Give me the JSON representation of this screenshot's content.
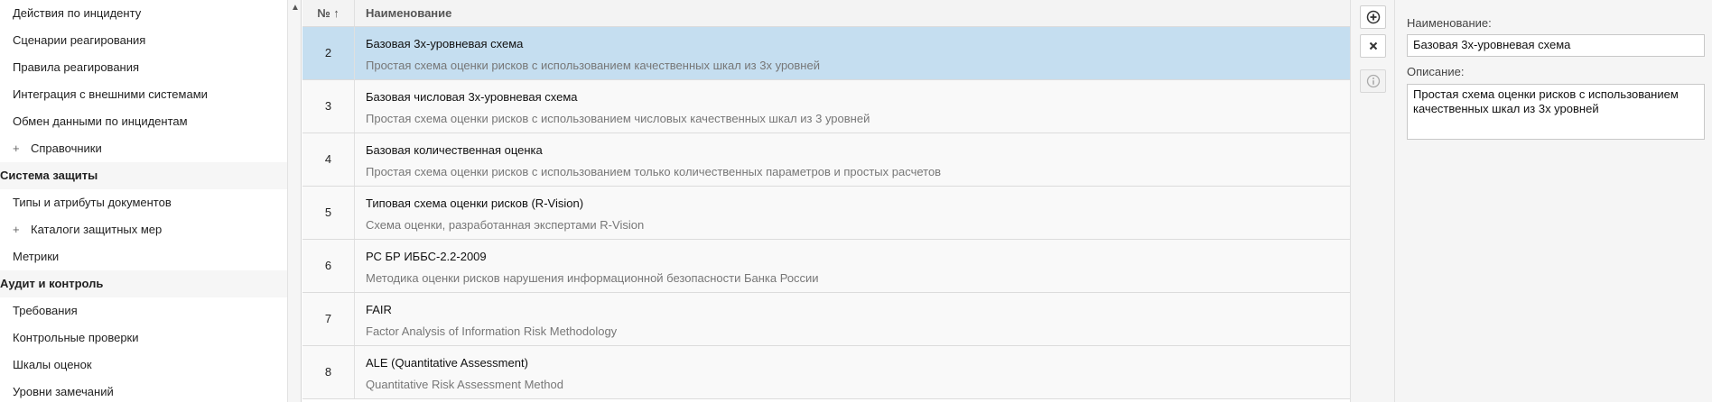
{
  "sidebar": {
    "items": [
      {
        "label": "Действия по инциденту",
        "type": "child"
      },
      {
        "label": "Сценарии реагирования",
        "type": "child"
      },
      {
        "label": "Правила реагирования",
        "type": "child"
      },
      {
        "label": "Интеграция с внешними системами",
        "type": "child"
      },
      {
        "label": "Обмен данными по инцидентам",
        "type": "child"
      },
      {
        "label": "Справочники",
        "type": "child",
        "expand": "+"
      },
      {
        "label": "Система защиты",
        "type": "group"
      },
      {
        "label": "Типы и атрибуты документов",
        "type": "child"
      },
      {
        "label": "Каталоги защитных мер",
        "type": "child",
        "expand": "+"
      },
      {
        "label": "Метрики",
        "type": "child"
      },
      {
        "label": "Аудит и контроль",
        "type": "group"
      },
      {
        "label": "Требования",
        "type": "child"
      },
      {
        "label": "Контрольные проверки",
        "type": "child"
      },
      {
        "label": "Шкалы оценок",
        "type": "child"
      },
      {
        "label": "Уровни замечаний",
        "type": "child"
      }
    ],
    "scroll_up": "▲"
  },
  "grid": {
    "columns": {
      "num": "№ ↑",
      "name": "Наименование"
    },
    "rows": [
      {
        "num": "2",
        "title": "Базовая 3х-уровневая схема",
        "desc": "Простая схема оценки рисков с использованием качественных шкал из 3х уровней",
        "selected": true
      },
      {
        "num": "3",
        "title": "Базовая числовая 3х-уровневая схема",
        "desc": "Простая схема оценки рисков с использованием числовых качественных шкал из 3 уровней"
      },
      {
        "num": "4",
        "title": "Базовая количественная оценка",
        "desc": "Простая схема оценки рисков с использованием только количественных параметров и простых расчетов"
      },
      {
        "num": "5",
        "title": "Типовая схема оценки рисков (R-Vision)",
        "desc": "Схема оценки, разработанная экспертами R-Vision"
      },
      {
        "num": "6",
        "title": "РС БР ИББС-2.2-2009",
        "desc": "Методика оценки рисков нарушения информационной безопасности Банка России"
      },
      {
        "num": "7",
        "title": "FAIR",
        "desc": "Factor Analysis of Information Risk Methodology"
      },
      {
        "num": "8",
        "title": "ALE (Quantitative Assessment)",
        "desc": "Quantitative Risk Assessment Method"
      }
    ]
  },
  "actions": {
    "add_icon": "plus-circle-icon",
    "delete_icon": "close-icon",
    "info_icon": "info-icon"
  },
  "detail": {
    "name_label": "Наименование:",
    "name_value": "Базовая 3х-уровневая схема",
    "desc_label": "Описание:",
    "desc_value": "Простая схема оценки рисков с использованием качественных шкал из 3х уровней"
  },
  "colors": {
    "selected_row": "#c5def0",
    "panel_bg": "#f5f5f5"
  }
}
